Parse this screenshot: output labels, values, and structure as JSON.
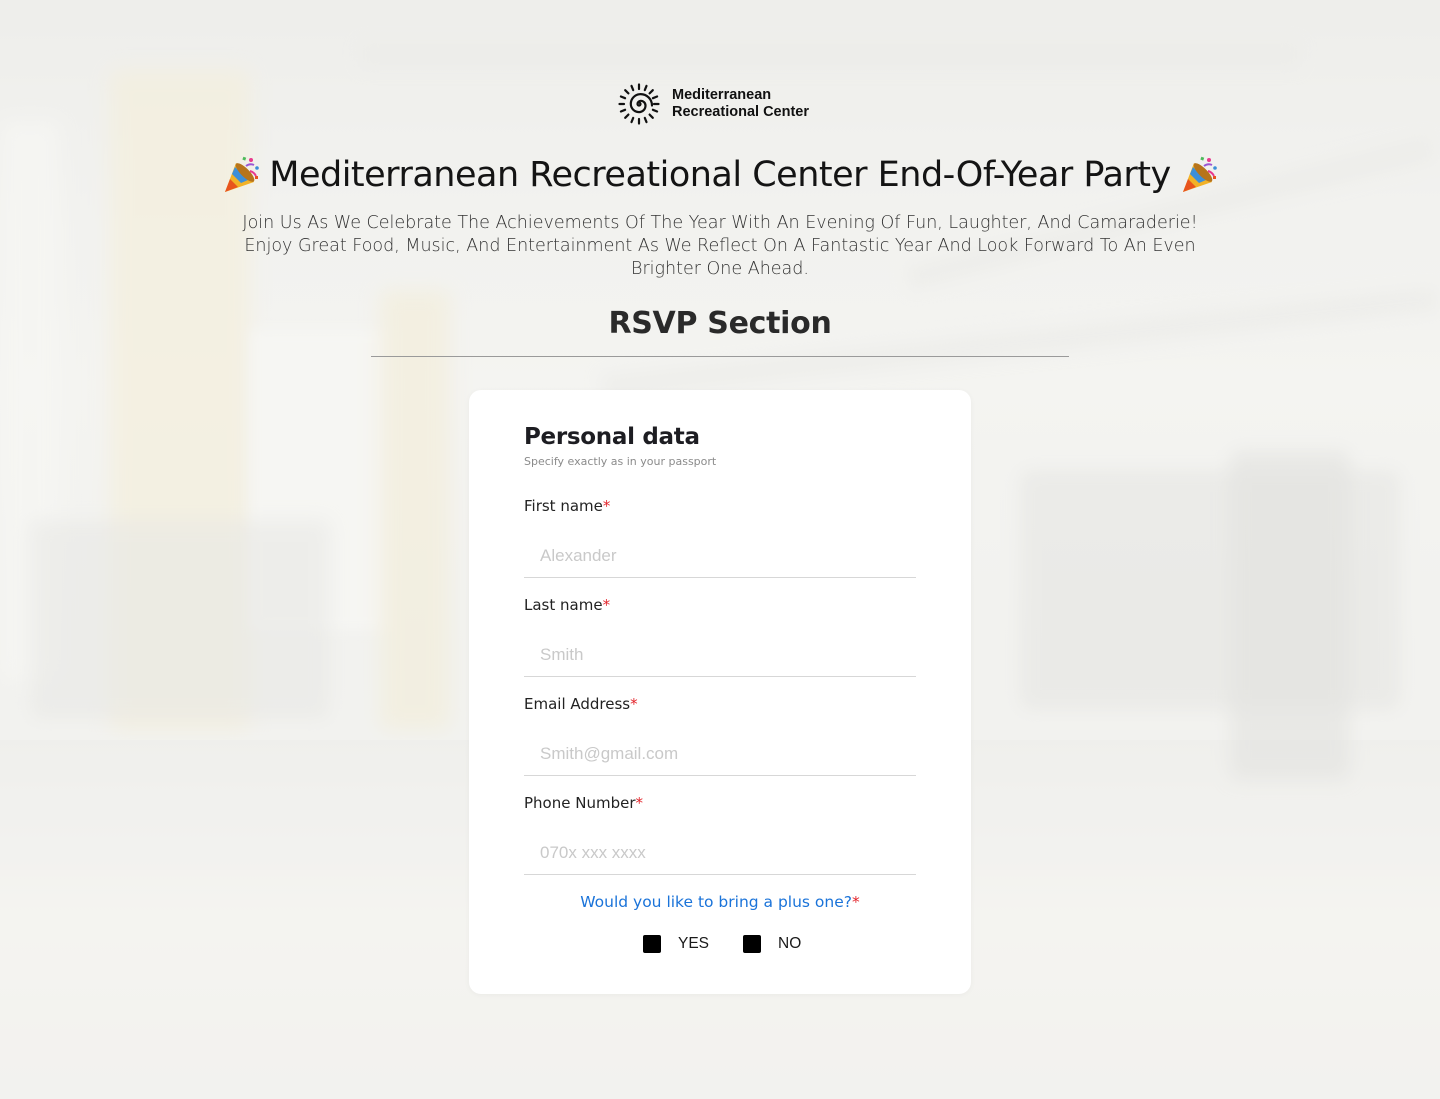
{
  "brand": {
    "name_line1": "Mediterranean",
    "name_line2": "Recreational Center",
    "logo_icon": "spiral-sun-icon"
  },
  "hero": {
    "title": "Mediterranean Recreational Center End-Of-Year Party",
    "title_icon": "party-popper-icon",
    "description": "Join Us As We Celebrate The Achievements Of The Year With An Evening Of Fun, Laughter, And Camaraderie! Enjoy Great Food, Music, And Entertainment As We Reflect On A Fantastic Year And Look Forward To An Even Brighter One Ahead."
  },
  "rsvp": {
    "heading": "RSVP Section"
  },
  "form": {
    "title": "Personal data",
    "subtitle": "Specify exactly as in your passport",
    "required_mark": "*",
    "fields": [
      {
        "label": "First name",
        "placeholder": "Alexander",
        "value": ""
      },
      {
        "label": "Last name",
        "placeholder": "Smith",
        "value": ""
      },
      {
        "label": "Email Address",
        "placeholder": "Smith@gmail.com",
        "value": ""
      },
      {
        "label": "Phone Number",
        "placeholder": "070x xxx xxxx",
        "value": ""
      }
    ],
    "plus_one_question": "Would you like to bring a plus one?",
    "options": [
      {
        "label": "YES",
        "checked": false
      },
      {
        "label": "NO",
        "checked": false
      }
    ]
  },
  "colors": {
    "accent_blue": "#1a73d9",
    "required_red": "#e3242b",
    "card_bg": "#ffffff",
    "checkbox": "#000000"
  }
}
